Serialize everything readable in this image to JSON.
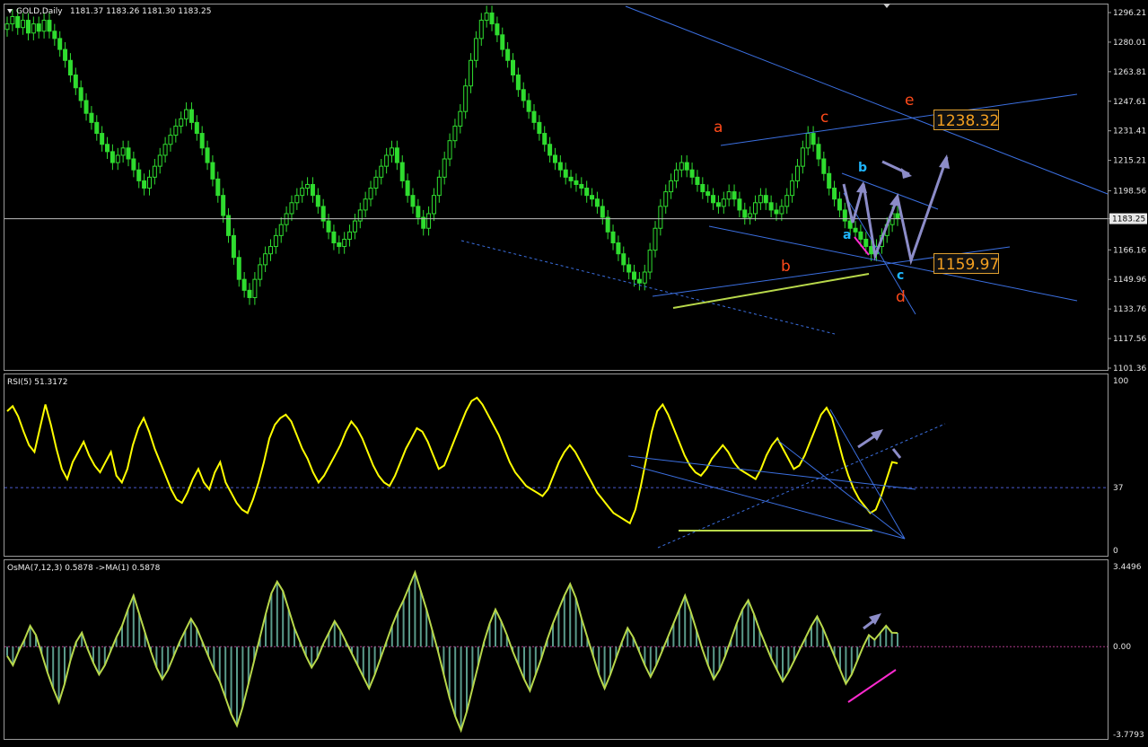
{
  "chart_data": [
    {
      "type": "candlestick",
      "title": "GOLD,Daily",
      "ohlc": [
        1181.37,
        1183.26,
        1181.3,
        1183.25
      ],
      "current_price": 1183.25,
      "ylim": [
        1101.36,
        1296.21
      ],
      "y_ticks": [
        "1296.21",
        "1280.01",
        "1263.81",
        "1247.61",
        "1231.41",
        "1215.21",
        "1198.56",
        "1183.25",
        "1166.16",
        "1149.96",
        "1133.76",
        "1117.56",
        "1101.36"
      ],
      "closes": [
        1290,
        1294,
        1288,
        1292,
        1285,
        1290,
        1286,
        1292,
        1286,
        1282,
        1276,
        1270,
        1262,
        1255,
        1248,
        1241,
        1236,
        1230,
        1224,
        1220,
        1214,
        1218,
        1222,
        1216,
        1210,
        1204,
        1200,
        1206,
        1212,
        1218,
        1224,
        1229,
        1234,
        1238,
        1243,
        1236,
        1230,
        1222,
        1214,
        1205,
        1196,
        1185,
        1174,
        1162,
        1150,
        1144,
        1140,
        1150,
        1158,
        1164,
        1168,
        1174,
        1180,
        1186,
        1192,
        1196,
        1200,
        1202,
        1196,
        1190,
        1182,
        1176,
        1170,
        1168,
        1172,
        1176,
        1182,
        1188,
        1194,
        1200,
        1206,
        1212,
        1218,
        1222,
        1214,
        1204,
        1196,
        1190,
        1184,
        1178,
        1186,
        1196,
        1206,
        1216,
        1226,
        1234,
        1242,
        1256,
        1270,
        1282,
        1292,
        1296,
        1290,
        1284,
        1276,
        1270,
        1262,
        1254,
        1248,
        1242,
        1236,
        1230,
        1224,
        1218,
        1214,
        1210,
        1206,
        1204,
        1202,
        1200,
        1196,
        1194,
        1190,
        1184,
        1176,
        1170,
        1164,
        1158,
        1154,
        1150,
        1148,
        1154,
        1166,
        1178,
        1190,
        1198,
        1204,
        1210,
        1214,
        1210,
        1206,
        1202,
        1198,
        1196,
        1192,
        1190,
        1194,
        1198,
        1194,
        1188,
        1184,
        1186,
        1192,
        1196,
        1192,
        1188,
        1186,
        1190,
        1196,
        1204,
        1212,
        1222,
        1230,
        1224,
        1216,
        1208,
        1200,
        1194,
        1188,
        1182,
        1178,
        1176,
        1172,
        1168,
        1164,
        1168,
        1174,
        1180,
        1186,
        1183.25
      ],
      "annotations": {
        "red_labels": [
          "a",
          "b",
          "c",
          "d",
          "e"
        ],
        "cyan_labels": [
          "a",
          "b",
          "c"
        ],
        "price_boxes": [
          "1238.32",
          "1159.97"
        ]
      }
    },
    {
      "type": "line",
      "title": "RSI(5) 51.3172",
      "ylim": [
        0,
        100
      ],
      "y_ticks": [
        "100",
        "37",
        "0"
      ],
      "level": 37,
      "values": [
        82,
        85,
        79,
        70,
        62,
        58,
        72,
        86,
        74,
        60,
        48,
        42,
        52,
        58,
        64,
        56,
        50,
        46,
        52,
        58,
        44,
        40,
        48,
        62,
        72,
        78,
        70,
        60,
        52,
        44,
        36,
        30,
        28,
        34,
        42,
        48,
        40,
        36,
        46,
        52,
        40,
        34,
        28,
        24,
        22,
        30,
        40,
        52,
        66,
        74,
        78,
        80,
        76,
        68,
        60,
        54,
        46,
        40,
        44,
        50,
        56,
        62,
        70,
        76,
        72,
        66,
        58,
        50,
        44,
        40,
        38,
        44,
        52,
        60,
        66,
        72,
        70,
        64,
        56,
        48,
        50,
        58,
        66,
        74,
        82,
        88,
        90,
        86,
        80,
        74,
        68,
        60,
        52,
        46,
        42,
        38,
        36,
        34,
        32,
        36,
        44,
        52,
        58,
        62,
        58,
        52,
        46,
        40,
        34,
        30,
        26,
        22,
        20,
        18,
        16,
        24,
        38,
        54,
        70,
        82,
        86,
        80,
        72,
        64,
        56,
        50,
        46,
        44,
        48,
        54,
        58,
        62,
        58,
        52,
        48,
        46,
        44,
        42,
        48,
        56,
        62,
        66,
        60,
        54,
        48,
        50,
        56,
        64,
        72,
        80,
        84,
        78,
        66,
        54,
        44,
        36,
        30,
        26,
        22,
        24,
        32,
        42,
        52,
        51.3172
      ]
    },
    {
      "type": "bar",
      "title": "OsMA(7,12,3) 0.5878  ->MA(1) 0.5878",
      "ylim": [
        -3.7793,
        3.4496
      ],
      "y_ticks": [
        "3.4496",
        "0.00",
        "-3.7793"
      ],
      "values": [
        -0.4,
        -0.8,
        -0.2,
        0.3,
        0.9,
        0.5,
        -0.3,
        -1.1,
        -1.8,
        -2.4,
        -1.6,
        -0.6,
        0.2,
        0.6,
        -0.1,
        -0.7,
        -1.2,
        -0.8,
        -0.2,
        0.4,
        0.9,
        1.6,
        2.2,
        1.4,
        0.6,
        -0.2,
        -0.9,
        -1.4,
        -1.0,
        -0.4,
        0.2,
        0.7,
        1.2,
        0.8,
        0.2,
        -0.4,
        -1.0,
        -1.5,
        -2.2,
        -2.9,
        -3.4,
        -2.6,
        -1.6,
        -0.6,
        0.4,
        1.4,
        2.3,
        2.8,
        2.4,
        1.6,
        0.8,
        0.2,
        -0.4,
        -0.9,
        -0.5,
        0.1,
        0.6,
        1.1,
        0.7,
        0.2,
        -0.3,
        -0.8,
        -1.3,
        -1.8,
        -1.2,
        -0.5,
        0.2,
        0.9,
        1.5,
        2.0,
        2.6,
        3.2,
        2.4,
        1.6,
        0.7,
        -0.2,
        -1.2,
        -2.2,
        -3.0,
        -3.6,
        -2.8,
        -1.8,
        -0.8,
        0.2,
        1.0,
        1.6,
        1.1,
        0.5,
        -0.2,
        -0.8,
        -1.4,
        -1.9,
        -1.2,
        -0.5,
        0.3,
        1.0,
        1.6,
        2.2,
        2.7,
        2.1,
        1.2,
        0.4,
        -0.4,
        -1.2,
        -1.8,
        -1.2,
        -0.5,
        0.2,
        0.8,
        0.4,
        -0.2,
        -0.8,
        -1.3,
        -0.8,
        -0.2,
        0.4,
        1.0,
        1.6,
        2.2,
        1.5,
        0.7,
        -0.1,
        -0.8,
        -1.4,
        -1.0,
        -0.4,
        0.3,
        1.0,
        1.6,
        2.0,
        1.4,
        0.7,
        0.1,
        -0.5,
        -1.0,
        -1.5,
        -1.1,
        -0.6,
        -0.1,
        0.4,
        0.9,
        1.3,
        0.8,
        0.2,
        -0.4,
        -1.0,
        -1.6,
        -1.2,
        -0.6,
        0.0,
        0.5,
        0.3,
        0.6,
        0.9,
        0.6,
        0.5878
      ]
    }
  ]
}
